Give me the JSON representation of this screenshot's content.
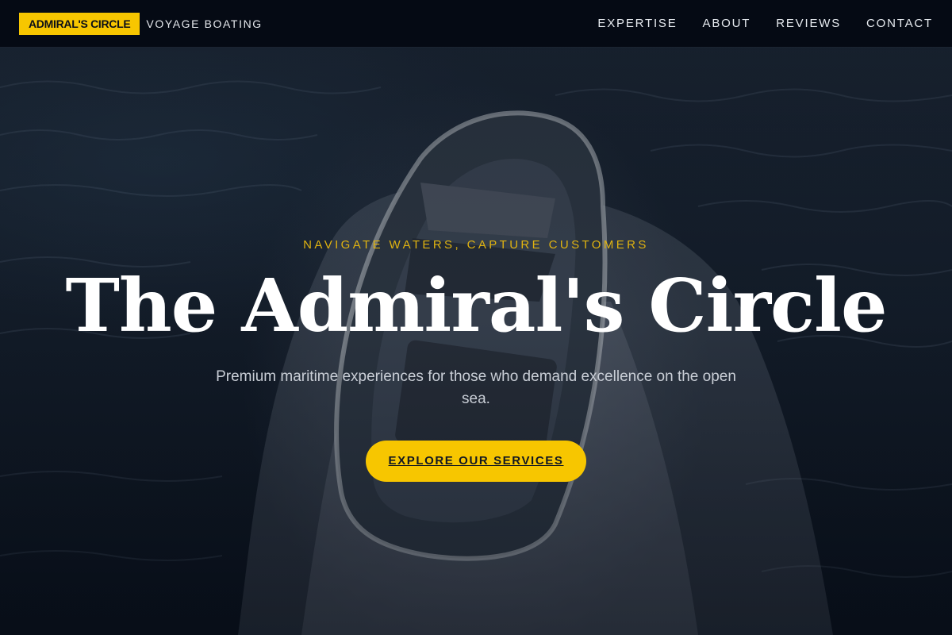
{
  "nav": {
    "brand_badge": "ADMIRAL'S CIRCLE",
    "brand_subtitle": "VOYAGE BOATING",
    "links": [
      {
        "label": "EXPERTISE"
      },
      {
        "label": "ABOUT"
      },
      {
        "label": "REVIEWS"
      },
      {
        "label": "CONTACT"
      }
    ]
  },
  "hero": {
    "eyebrow": "NAVIGATE WATERS, CAPTURE CUSTOMERS",
    "title": "The Admiral's Circle",
    "description": "Premium maritime experiences for those who demand excellence on the open sea.",
    "cta_label": "EXPLORE OUR SERVICES",
    "background_image": "speedboat-on-dark-water"
  },
  "colors": {
    "accent": "#f7c600",
    "nav_bg": "#050a14",
    "eyebrow": "#e0b310",
    "title": "#ffffff"
  }
}
